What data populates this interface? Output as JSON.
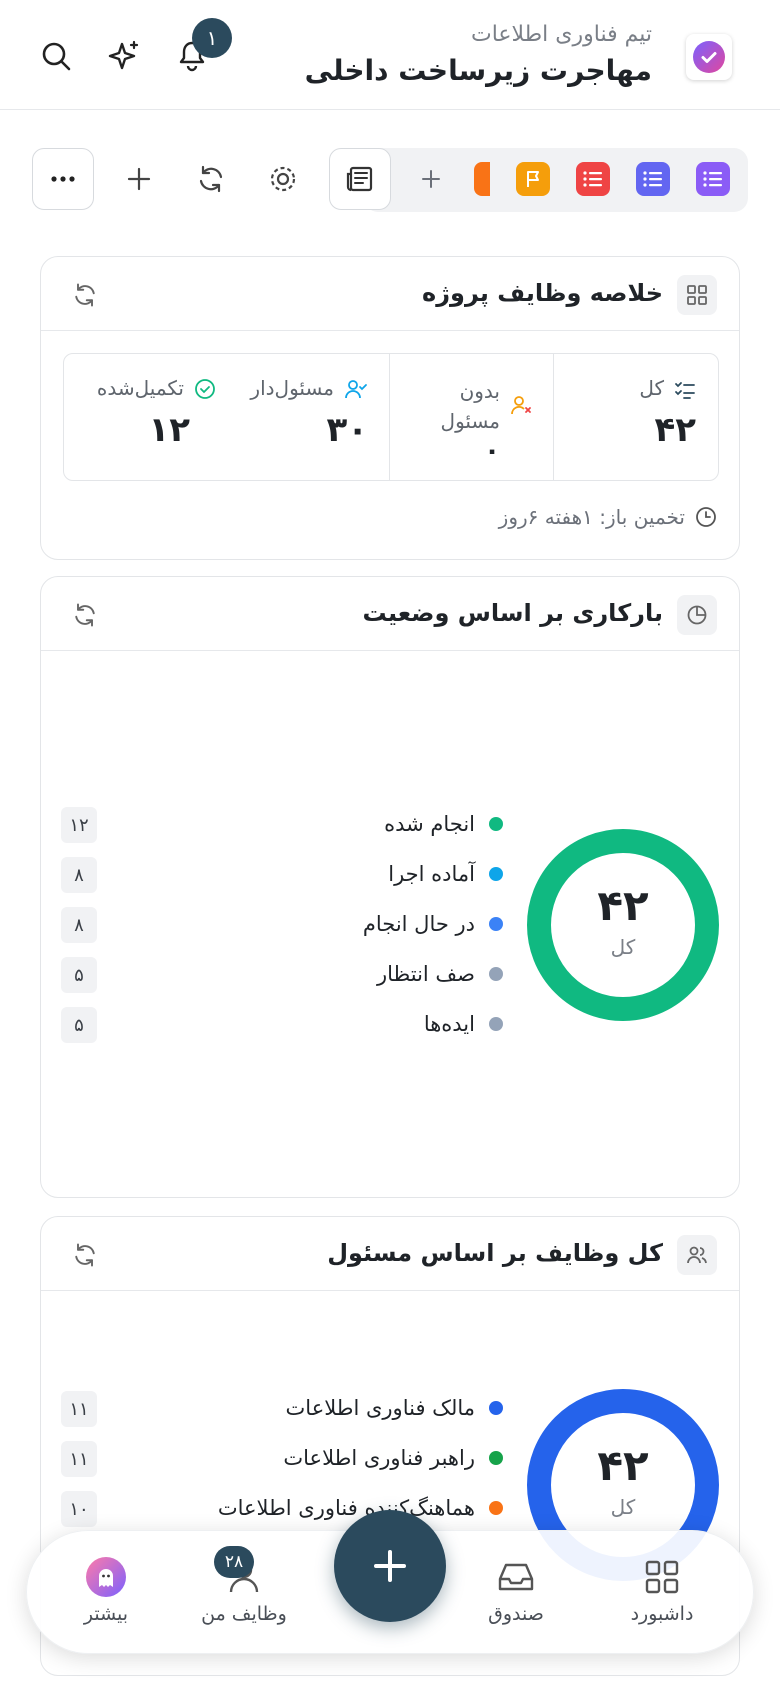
{
  "header": {
    "team": "تیم فناوری اطلاعات",
    "project": "مهاجرت زیرساخت داخلی",
    "notifications_count": "۱",
    "icons": [
      "app-logo-icon",
      "bell-icon",
      "sparkles-icon",
      "search-icon"
    ]
  },
  "toolbar": {
    "pills": [
      "list-view-purple",
      "list-view-indigo",
      "list-view-red",
      "flag-view-amber",
      "view-orange-partial"
    ],
    "pill_colors": [
      "#8b5cf6",
      "#6366f1",
      "#ef4444",
      "#f59e0b",
      "#f97316"
    ],
    "icons": [
      "plus-icon",
      "newspaper-icon",
      "settings-icon",
      "refresh-icon",
      "plus-icon",
      "more-icon"
    ]
  },
  "summary": {
    "title": "خلاصه وظایف پروژه",
    "total_label": "کل",
    "total_value": "۴۲",
    "unassigned_label": "بدون مسئول",
    "unassigned_value": "۰",
    "assigned_label": "مسئول‌دار",
    "assigned_value": "۳۰",
    "completed_label": "تکمیل‌شده",
    "completed_value": "۱۲",
    "estimate": "تخمین باز: ۱هفته ۶روز"
  },
  "workload_status": {
    "title": "بارکاری بر اساس وضعیت",
    "total": "۴۲",
    "total_label": "کل",
    "items": [
      {
        "label": "انجام شده",
        "count": "۱۲",
        "color": "#10b981"
      },
      {
        "label": "آماده اجرا",
        "count": "۸",
        "color": "#0ea5e9"
      },
      {
        "label": "در حال انجام",
        "count": "۸",
        "color": "#3b82f6"
      },
      {
        "label": "صف انتظار",
        "count": "۵",
        "color": "#94a3b8"
      },
      {
        "label": "ایده‌ها",
        "count": "۵",
        "color": "#94a3b8"
      }
    ],
    "ring_color": "#10b981"
  },
  "tasks_by_assignee": {
    "title": "کل وظایف بر اساس مسئول",
    "total": "۴۲",
    "total_label": "کل",
    "items": [
      {
        "label": "مالک فناوری اطلاعات",
        "count": "۱۱",
        "color": "#2563eb"
      },
      {
        "label": "راهبر فناوری اطلاعات",
        "count": "۱۱",
        "color": "#16a34a"
      },
      {
        "label": "هماهنگ‌کننده فناوری اطلاعات",
        "count": "۱۰",
        "color": "#f97316"
      }
    ],
    "ring_color": "#2563eb"
  },
  "bottom_nav": {
    "dashboard": "داشبورد",
    "inbox": "صندوق",
    "my_tasks": "وظایف من",
    "my_tasks_count": "۲۸",
    "more": "بیشتر"
  }
}
